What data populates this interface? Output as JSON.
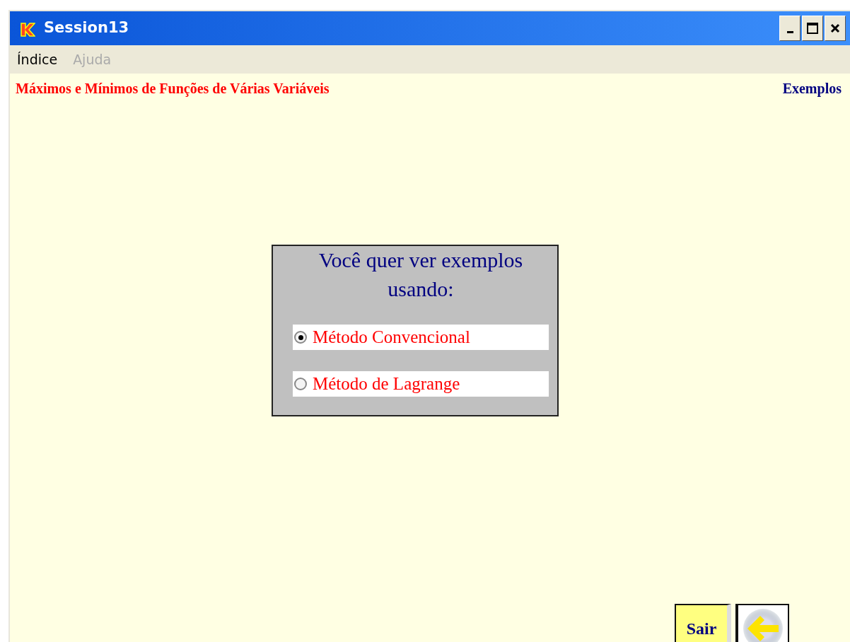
{
  "window": {
    "title": "Session13"
  },
  "menu": [
    {
      "label": "Índice",
      "disabled": false
    },
    {
      "label": "Ajuda",
      "disabled": true
    }
  ],
  "header": {
    "title": "Máximos e Mínimos de Funções de Várias Variáveis",
    "section": "Exemplos"
  },
  "dialog": {
    "question": "Você quer ver exemplos usando:",
    "options": [
      {
        "label": "Método Convencional",
        "selected": true
      },
      {
        "label": "Método de Lagrange",
        "selected": false
      }
    ]
  },
  "buttons": [
    {
      "kind": "text",
      "label": "Sair"
    },
    {
      "kind": "back"
    }
  ]
}
